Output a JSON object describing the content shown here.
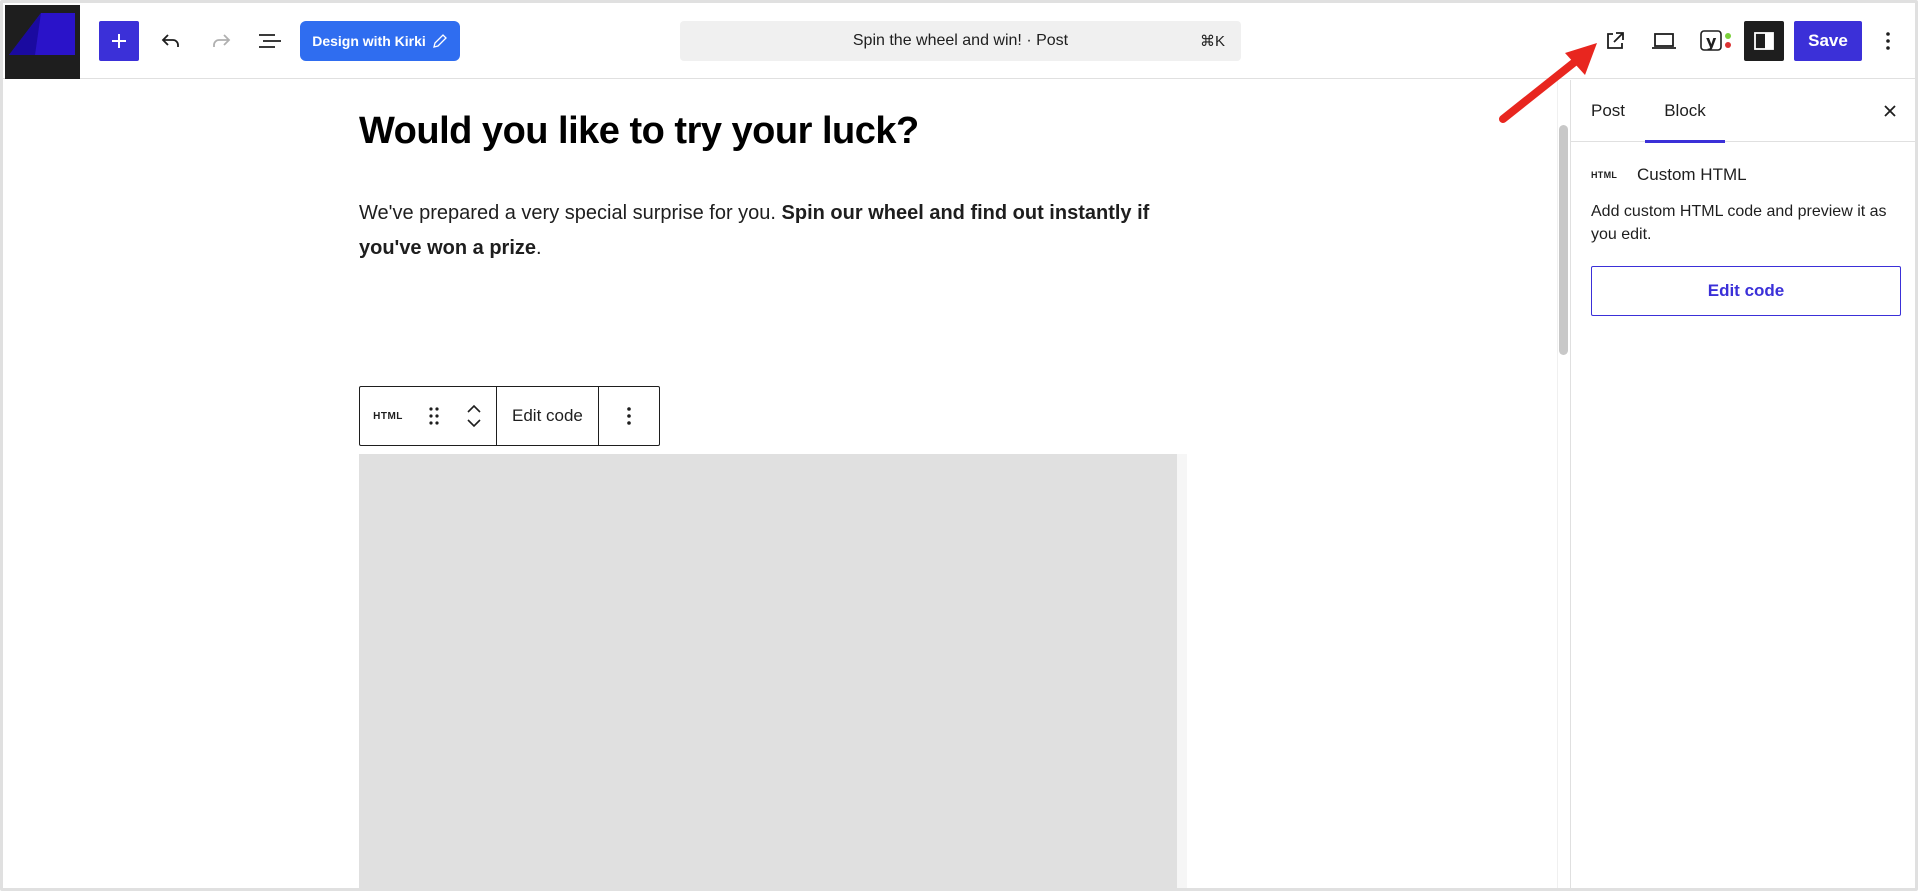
{
  "toolbar": {
    "add_label": "+",
    "kirki_label": "Design with Kirki",
    "command_title": "Spin the wheel and win! · Post",
    "command_shortcut": "⌘K",
    "save_label": "Save",
    "icons": {
      "add": "plus-icon",
      "undo": "undo-icon",
      "redo": "redo-icon",
      "list_view": "list-view-icon",
      "kirki": "pencil-icon",
      "preview": "external-link-icon",
      "device": "laptop-icon",
      "yoast": "yoast-icon",
      "settings": "sidebar-icon",
      "more": "more-vertical-icon"
    }
  },
  "editor": {
    "heading": "Would you like to try your luck?",
    "paragraph_plain": "We've prepared a very special surprise for you. ",
    "paragraph_bold": "Spin our wheel and find out instantly if you've won a prize",
    "paragraph_end": ".",
    "block_toolbar": {
      "type_label": "HTML",
      "edit_label": "Edit code"
    }
  },
  "sidebar": {
    "tabs": [
      {
        "label": "Post",
        "active": false
      },
      {
        "label": "Block",
        "active": true
      }
    ],
    "block_icon_label": "HTML",
    "block_title": "Custom HTML",
    "block_description": "Add custom HTML code and preview it as you edit.",
    "edit_button": "Edit code"
  },
  "colors": {
    "accent": "#3b30d8",
    "kirki": "#2f6df0",
    "annotation_arrow": "#e8261f",
    "logo_bg": "#1e1e1e",
    "logo_shape": "#2a13c9"
  }
}
